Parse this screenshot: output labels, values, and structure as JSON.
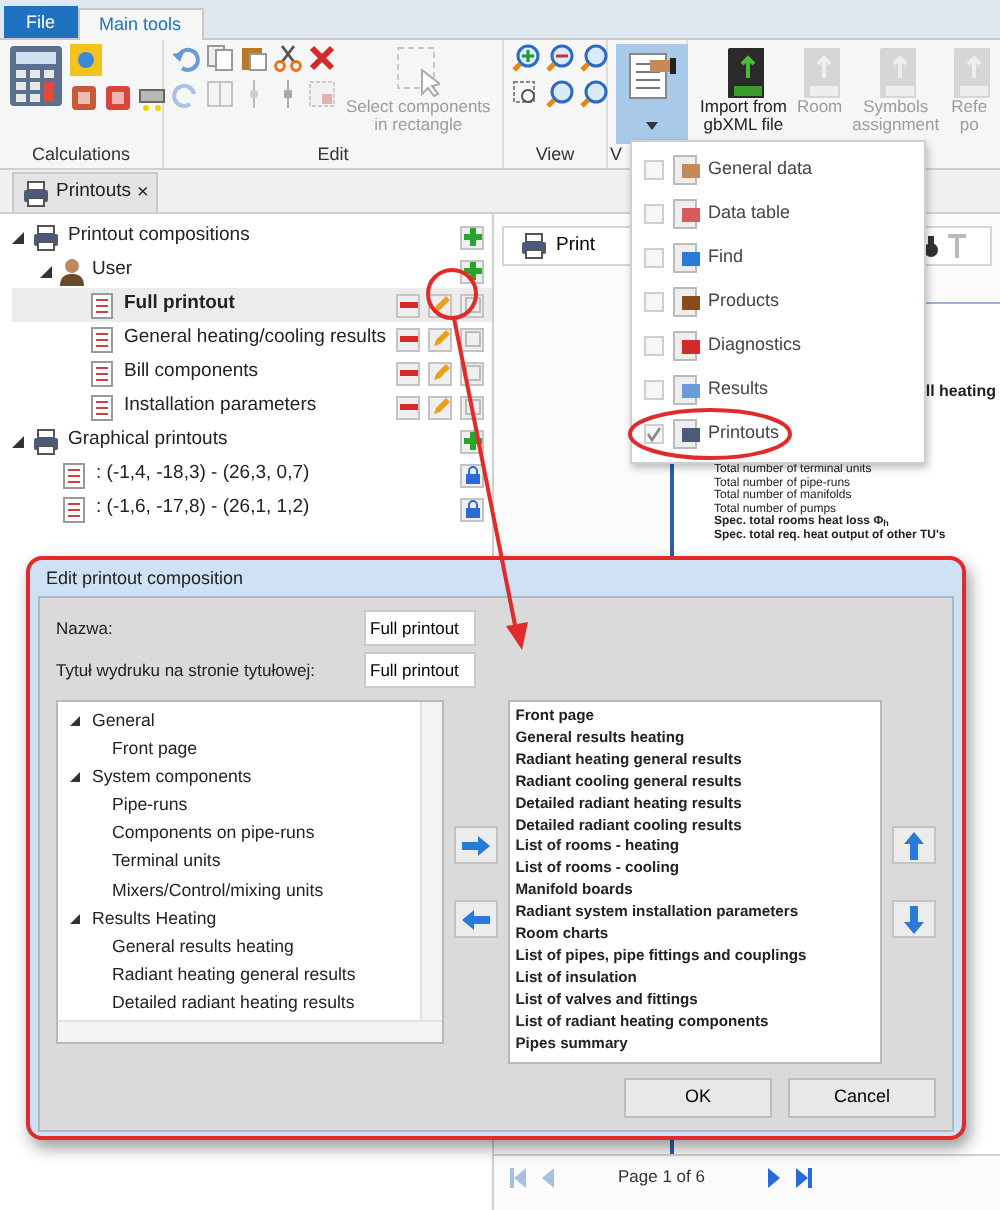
{
  "ribbon_tabs": [
    {
      "label": "File",
      "selected": false
    },
    {
      "label": "Main tools",
      "selected": true
    }
  ],
  "ribbon": {
    "groups": [
      {
        "kind": "calc",
        "label": "Calculations"
      },
      {
        "kind": "edit",
        "label": "Edit",
        "buttons": [
          {
            "lines": [
              "Select components",
              "in rectangle"
            ],
            "disabled": true
          }
        ]
      },
      {
        "kind": "view",
        "label": "View"
      },
      {
        "kind": "window",
        "label": "V",
        "expanded": true
      },
      {
        "kind": "import",
        "buttons": [
          {
            "lines": [
              "Import from",
              "gbXML file"
            ],
            "disabled": false
          },
          {
            "lines": [
              "Room"
            ],
            "disabled": true
          },
          {
            "lines": [
              "Symbols",
              "assignment"
            ],
            "disabled": true
          },
          {
            "lines": [
              "Refe",
              "po"
            ],
            "disabled": true
          }
        ]
      }
    ]
  },
  "window_menu": [
    {
      "label": "General data",
      "checked": false
    },
    {
      "label": "Data table",
      "checked": false
    },
    {
      "label": "Find",
      "checked": false
    },
    {
      "label": "Products",
      "checked": false
    },
    {
      "label": "Diagnostics",
      "checked": false
    },
    {
      "label": "Results",
      "checked": false
    },
    {
      "label": "Printouts",
      "checked": true
    }
  ],
  "doc_tab": {
    "label": "Printouts",
    "close": "×"
  },
  "tree": [
    {
      "kind": "group",
      "label": "Printout compositions",
      "expanded": true,
      "children": [
        {
          "kind": "user",
          "label": "User",
          "expanded": true,
          "children": [
            {
              "kind": "composition",
              "label": "Full printout",
              "selected": true
            },
            {
              "kind": "composition",
              "label": "General heating/cooling results",
              "selected": false
            },
            {
              "kind": "composition",
              "label": "Bill  components",
              "selected": false
            },
            {
              "kind": "composition",
              "label": "Installation parameters",
              "selected": false
            }
          ]
        }
      ]
    },
    {
      "kind": "group",
      "label": "Graphical printouts",
      "expanded": true,
      "children": [
        {
          "kind": "graphic",
          "label": ": (-1,4, -18,3) - (26,3, 0,7)",
          "selected": false
        },
        {
          "kind": "graphic",
          "label": ": (-1,6, -17,8) - (26,1, 1,2)",
          "selected": false
        }
      ]
    }
  ],
  "preview": {
    "toolbar": {
      "print": "Print"
    },
    "heading": "ll heating",
    "lines": [
      {
        "text": "Total number of terminal units",
        "bold": false
      },
      {
        "text": "Total number of pipe-runs",
        "bold": false
      },
      {
        "text": "Total number of manifolds",
        "bold": false
      },
      {
        "text": "Total number of pumps",
        "bold": false
      },
      {
        "text": "Spec. total rooms heat loss Φ$_{h}$",
        "bold": true
      },
      {
        "text": "Spec. total req. heat output of other TU's",
        "bold": true
      }
    ],
    "pager": "Page 1 of 6"
  },
  "dialog": {
    "title": "Edit printout composition",
    "fields": [
      {
        "label": "Nazwa:",
        "value": "Full printout"
      },
      {
        "label": "Tytuł wydruku na stronie tytułowej:",
        "value": "Full printout"
      }
    ],
    "available": [
      {
        "label": "General",
        "expanded": true,
        "children": [
          {
            "label": "Front page"
          }
        ]
      },
      {
        "label": "System components",
        "expanded": true,
        "children": [
          {
            "label": "Pipe-runs"
          },
          {
            "label": "Components on pipe-runs"
          },
          {
            "label": "Terminal units"
          },
          {
            "label": "Mixers/Control/mixing units"
          }
        ]
      },
      {
        "label": "Results Heating",
        "expanded": true,
        "children": [
          {
            "label": "General results heating"
          },
          {
            "label": "Radiant heating general results"
          },
          {
            "label": "Detailed radiant heating results"
          }
        ]
      }
    ],
    "chosen": [
      "Front page",
      "General results heating",
      "Radiant heating general results",
      "Radiant cooling general results",
      "Detailed radiant heating results",
      "Detailed radiant cooling results",
      "List of rooms - heating",
      "List of rooms - cooling",
      "Manifold boards",
      "Radiant system installation parameters",
      "Room charts",
      "List of pipes, pipe fittings and couplings",
      "List of insulation",
      "List of valves and fittings",
      "List of radiant heating components",
      "Pipes summary"
    ],
    "buttons": [
      "OK",
      "Cancel"
    ]
  }
}
